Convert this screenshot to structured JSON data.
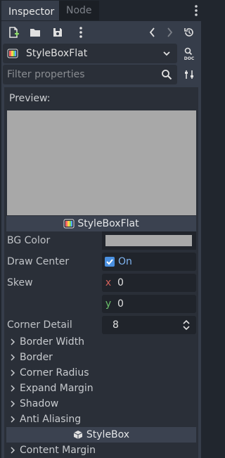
{
  "tabs": {
    "inspector": "Inspector",
    "node": "Node"
  },
  "resource": {
    "type_name": "StyleBoxFlat"
  },
  "filter": {
    "placeholder": "Filter properties",
    "value": ""
  },
  "preview": {
    "label": "Preview:",
    "header": "StyleBoxFlat"
  },
  "properties": {
    "bg_color": {
      "label": "BG Color",
      "value": "#a8a8a8"
    },
    "draw_center": {
      "label": "Draw Center",
      "value_label": "On",
      "checked": true
    },
    "skew": {
      "label": "Skew",
      "x_axis": "x",
      "x_value": "0",
      "y_axis": "y",
      "y_value": "0"
    },
    "corner_detail": {
      "label": "Corner Detail",
      "value": "8"
    }
  },
  "groups": [
    "Border Width",
    "Border",
    "Corner Radius",
    "Expand Margin",
    "Shadow",
    "Anti Aliasing"
  ],
  "stylebox_section": {
    "header": "StyleBox",
    "groups": [
      "Content Margin"
    ]
  },
  "colors": {
    "accent": "#4a90e0",
    "axis_x": "#d0605a",
    "axis_y": "#6ac06a",
    "panel_bg": "#363d4a",
    "field_bg": "#20242b"
  }
}
